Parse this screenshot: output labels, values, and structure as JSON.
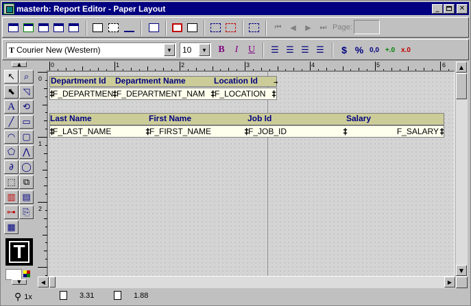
{
  "window": {
    "title": "masterb: Report Editor - Paper Layout",
    "controls": [
      "minimize",
      "maximize",
      "close"
    ]
  },
  "toolbar1": {
    "buttons": [
      "new-report-icon",
      "open-icon",
      "data-model-icon",
      "run-icon",
      "preview-icon",
      "body-icon",
      "margin-icon",
      "header-icon",
      "insert-icon",
      "confine-icon",
      "flex-icon",
      "select-parent-icon"
    ],
    "nav": [
      "first-page-icon",
      "previous-page-icon",
      "next-page-icon",
      "last-page-icon"
    ],
    "page_label": "Page:",
    "page_value": ""
  },
  "toolbar2": {
    "font": "Courier New (Western)",
    "size": "10",
    "bold": "B",
    "italic": "I",
    "underline": "U",
    "currency": "$",
    "percent": "%",
    "commas": "0,0",
    "add_decimal": "+.0",
    "remove_decimal": "x.0"
  },
  "palette": {
    "text_tool": "A",
    "big_label": "T"
  },
  "ruler": {
    "h_labels": [
      "0",
      "1",
      "2",
      "3",
      "4",
      "5",
      "6"
    ],
    "v_labels": [
      "0",
      "1",
      "2"
    ]
  },
  "layout": {
    "group1_headers": [
      "Department Id",
      "Department Name",
      "Location Id"
    ],
    "group1_fields": [
      "F_DEPARTMEN",
      "F_DEPARTMENT_NAM",
      "F_LOCATION"
    ],
    "group2_headers": [
      "Last Name",
      "First Name",
      "Job Id",
      "Salary"
    ],
    "group2_fields": [
      "F_LAST_NAME",
      "F_FIRST_NAME",
      "F_JOB_ID",
      "F_SALARY"
    ]
  },
  "status": {
    "zoom": "1x",
    "x": "3.31",
    "y": "1.88"
  },
  "colors": {
    "title_bar": "#000080",
    "header_band": "#cccc99",
    "record_band": "#ffffee",
    "label_text": "#000080"
  }
}
